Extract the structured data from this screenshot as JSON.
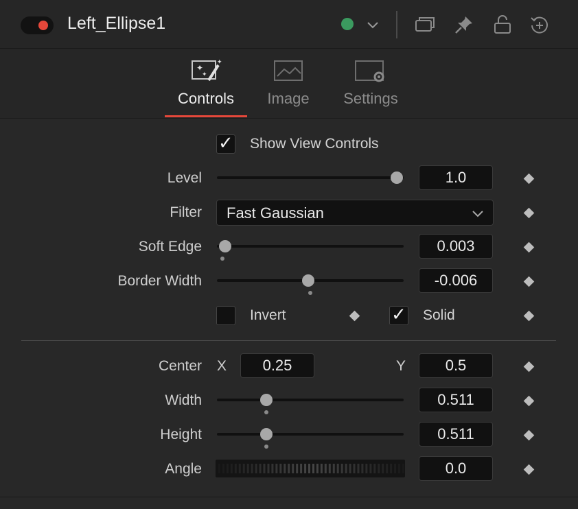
{
  "header": {
    "node_name": "Left_Ellipse1",
    "color_dot": "#3b9a5f",
    "toggle_color": "#e5473a",
    "icons": [
      "chevron-down-icon",
      "windows-icon",
      "pin-icon",
      "lock-icon",
      "reset-icon"
    ]
  },
  "tabs": [
    {
      "label": "Controls",
      "icon": "magic-wand-icon",
      "active": true
    },
    {
      "label": "Image",
      "icon": "image-icon",
      "active": false
    },
    {
      "label": "Settings",
      "icon": "settings-icon",
      "active": false
    }
  ],
  "accent_color": "#e5473a",
  "controls": {
    "show_view_controls": {
      "label": "Show View Controls",
      "checked": true
    },
    "level": {
      "label": "Level",
      "value": "1.0"
    },
    "filter": {
      "label": "Filter",
      "value": "Fast Gaussian"
    },
    "soft_edge": {
      "label": "Soft Edge",
      "value": "0.003"
    },
    "border_width": {
      "label": "Border Width",
      "value": "-0.006"
    },
    "invert": {
      "label": "Invert",
      "checked": false
    },
    "solid": {
      "label": "Solid",
      "checked": true
    },
    "center": {
      "label": "Center",
      "x_label": "X",
      "x_value": "0.25",
      "y_label": "Y",
      "y_value": "0.5"
    },
    "width": {
      "label": "Width",
      "value": "0.511"
    },
    "height": {
      "label": "Height",
      "value": "0.511"
    },
    "angle": {
      "label": "Angle",
      "value": "0.0"
    }
  }
}
